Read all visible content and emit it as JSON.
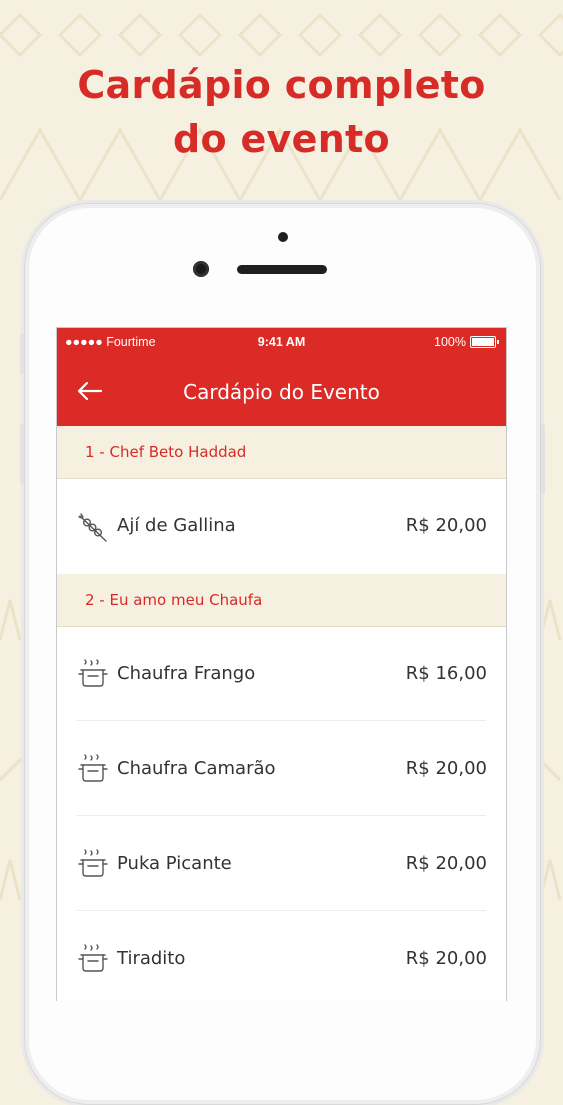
{
  "headline": {
    "line1": "Cardápio completo",
    "line2": "do evento"
  },
  "status_bar": {
    "carrier": "●●●●● Fourtime",
    "time": "9:41 AM",
    "battery": "100%"
  },
  "nav": {
    "title": "Cardápio do Evento",
    "back_icon": "arrow-left-icon"
  },
  "colors": {
    "brand": "#dc2a26",
    "background": "#f6f0e0",
    "accent_text": "#d62b27"
  },
  "sections": [
    {
      "title": "1 - Chef Beto Haddad",
      "items": [
        {
          "name": "Ají de Gallina",
          "price": "R$ 20,00",
          "icon": "skewer-icon"
        }
      ]
    },
    {
      "title": "2 - Eu amo meu Chaufa",
      "items": [
        {
          "name": "Chaufra Frango",
          "price": "R$ 16,00",
          "icon": "cooking-pot-icon"
        },
        {
          "name": "Chaufra Camarão",
          "price": "R$ 20,00",
          "icon": "cooking-pot-icon"
        },
        {
          "name": "Puka Picante",
          "price": "R$ 20,00",
          "icon": "cooking-pot-icon"
        },
        {
          "name": "Tiradito",
          "price": "R$ 20,00",
          "icon": "cooking-pot-icon"
        }
      ]
    }
  ]
}
